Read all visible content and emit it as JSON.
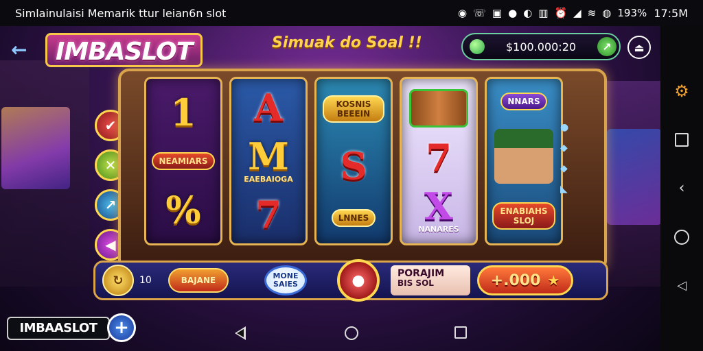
{
  "status_bar": {
    "title": "Simlainulaisi Memarik ttur leian6n slot",
    "icons": [
      "media-icon",
      "call-icon",
      "photo-icon",
      "location-icon",
      "nfc-icon",
      "vibrate-icon",
      "alarm-icon",
      "signal-icon",
      "wifi-icon",
      "battery-icon"
    ],
    "battery": "193%",
    "time": "17:5M"
  },
  "header": {
    "logo": "IMBASLOT",
    "banner": "Simuak do Soal !!",
    "balance": "$100.000:20",
    "add_symbol": "↗",
    "exit_symbol": "⏏"
  },
  "reels": [
    {
      "top": "1",
      "mid": "NEAMIARS",
      "bot": "%"
    },
    {
      "top": "A",
      "mid_big": "M",
      "mid_caption": "EAEBAIOGA",
      "bot": "7"
    },
    {
      "top": "KOSNIS BEEEIN",
      "mid": "S",
      "bot": "LNNES"
    },
    {
      "top": "",
      "mid": "7",
      "bot": "X",
      "bot_caption": "NANARES"
    },
    {
      "top": "NNARS",
      "mid": "",
      "bot": "ENABIAHS SLOJ"
    }
  ],
  "side_buttons": [
    "✔",
    "✕",
    "↗",
    "◀"
  ],
  "controls": {
    "coin_symbol": "↻",
    "coin_count": "10",
    "chip1": "BAJANE",
    "chip2": "MONE SAIES",
    "spin_symbol": "●",
    "promo_line1": "PORAJIM",
    "promo_line2": "BIS SOL",
    "bet": "+.000",
    "bet_star": "★"
  },
  "bottom": {
    "brand": "IMBAASLOT",
    "plus": "+"
  },
  "colors": {
    "accent_gold": "#ffd750",
    "bg_purple": "#3c1758",
    "balance_border": "#6ad0a0"
  }
}
